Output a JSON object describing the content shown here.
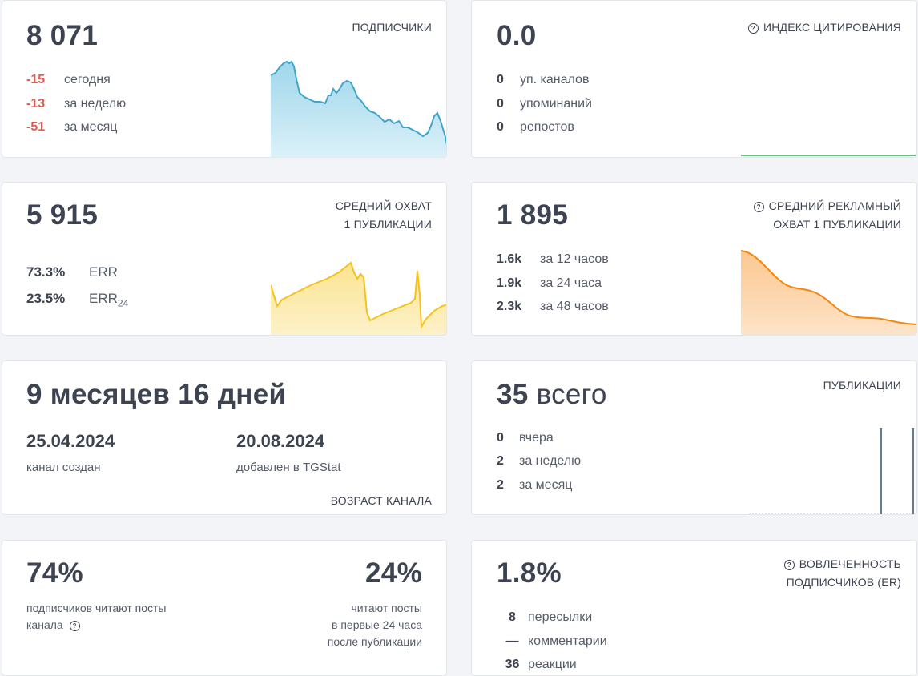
{
  "subscribers": {
    "value": "8 071",
    "label": "ПОДПИСЧИКИ",
    "rows": [
      {
        "num": "-15",
        "text": "сегодня"
      },
      {
        "num": "-13",
        "text": "за неделю"
      },
      {
        "num": "-51",
        "text": "за месяц"
      }
    ],
    "color": "#42a4c9"
  },
  "citation": {
    "value": "0.0",
    "label": "ИНДЕКС ЦИТИРОВАНИЯ",
    "help_icon": "question-circle-icon",
    "rows": [
      {
        "num": "0",
        "text": "уп. каналов"
      },
      {
        "num": "0",
        "text": "упоминаний"
      },
      {
        "num": "0",
        "text": "репостов"
      }
    ],
    "color": "#3aa757"
  },
  "reach": {
    "value": "5 915",
    "label_line1": "СРЕДНИЙ ОХВАТ",
    "label_line2": "1 ПУБЛИКАЦИИ",
    "err_value": "73.3%",
    "err_label": "ERR",
    "err24_value": "23.5%",
    "err24_label": "ERR",
    "err24_sub": "24",
    "color": "#f5c21a"
  },
  "ad_reach": {
    "value": "1 895",
    "label_line1": "СРЕДНИЙ РЕКЛАМНЫЙ",
    "label_line2": "ОХВАТ 1 ПУБЛИКАЦИИ",
    "help_icon": "question-circle-icon",
    "rows": [
      {
        "num": "1.6k",
        "text": "за 12 часов"
      },
      {
        "num": "1.9k",
        "text": "за 24 часа"
      },
      {
        "num": "2.3k",
        "text": "за 48 часов"
      }
    ],
    "color": "#f5870f"
  },
  "age": {
    "value": "9 месяцев 16 дней",
    "created_date": "25.04.2024",
    "created_label": "канал создан",
    "added_date": "20.08.2024",
    "added_label": "добавлен в TGStat",
    "label": "ВОЗРАСТ КАНАЛА"
  },
  "posts": {
    "value": "35",
    "value_suffix": "всего",
    "label": "ПУБЛИКАЦИИ",
    "rows": [
      {
        "num": "0",
        "text": "вчера"
      },
      {
        "num": "2",
        "text": "за неделю"
      },
      {
        "num": "2",
        "text": "за месяц"
      }
    ],
    "color": "#6d7a86"
  },
  "readers": {
    "left_value": "74%",
    "left_text_line1": "подписчиков читают посты",
    "left_text_line2": "канала",
    "help_icon": "question-circle-icon",
    "right_value": "24%",
    "right_text_line1": "читают посты",
    "right_text_line2": "в первые 24 часа",
    "right_text_line3": "после публикации"
  },
  "engagement": {
    "value": "1.8%",
    "label_line1": "ВОВЛЕЧЕННОСТЬ",
    "label_line2": "ПОДПИСЧИКОВ (ER)",
    "help_icon": "question-circle-icon",
    "rows": [
      {
        "num": "8",
        "text": "пересылки"
      },
      {
        "num": "—",
        "text": "комментарии"
      },
      {
        "num": "36",
        "text": "реакции"
      }
    ]
  }
}
